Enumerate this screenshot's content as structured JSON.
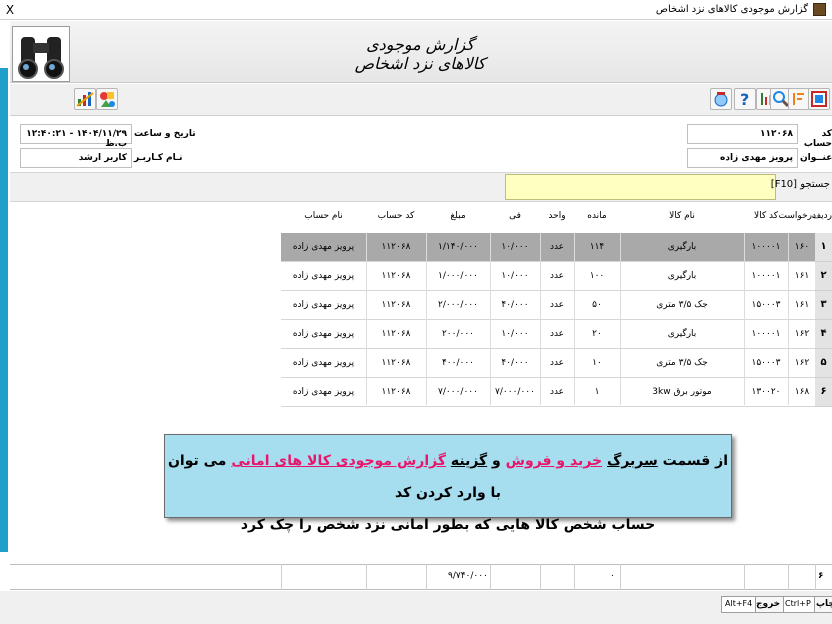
{
  "window": {
    "title": "گزارش موجودی کالاهای نزد اشخاص",
    "close_label": "X"
  },
  "header": {
    "title": "گزارش موجودی کالاهای نزد اشخاص"
  },
  "info": {
    "account_code_label": "کد حساب",
    "account_code_value": "۱۱۲۰۶۸",
    "title_label": "عنــوان",
    "title_value": "پرویز مهدی زاده",
    "datetime_label": "تاریخ و ساعت",
    "datetime_value": "۱۴۰۴/۱۱/۲۹ - ۱۲:۴۰:۲۱ ب.ظ",
    "user_label": "نـام کـاربـر",
    "user_value": "کاربر ارشد"
  },
  "search": {
    "label": "جستجو [F10]",
    "value": ""
  },
  "table": {
    "columns": [
      "ردیف",
      "درخواست",
      "کد کالا",
      "نام کالا",
      "مانده",
      "واحد",
      "فی",
      "مبلغ",
      "کد حساب",
      "نام حساب"
    ],
    "rows": [
      {
        "idx": "۱",
        "req": "۱۶۰",
        "code": "۱۰۰۰۰۱",
        "name": "بارگیری",
        "rem": "۱۱۴",
        "unit": "عدد",
        "price": "۱۰/۰۰۰",
        "amount": "۱/۱۴۰/۰۰۰",
        "acc": "۱۱۲۰۶۸",
        "accname": "پرویز مهدی زاده"
      },
      {
        "idx": "۲",
        "req": "۱۶۱",
        "code": "۱۰۰۰۰۱",
        "name": "بارگیری",
        "rem": "۱۰۰",
        "unit": "عدد",
        "price": "۱۰/۰۰۰",
        "amount": "۱/۰۰۰/۰۰۰",
        "acc": "۱۱۲۰۶۸",
        "accname": "پرویز مهدی زاده"
      },
      {
        "idx": "۳",
        "req": "۱۶۱",
        "code": "۱۵۰۰۰۳",
        "name": "جک ۳/۵ متری",
        "rem": "۵۰",
        "unit": "عدد",
        "price": "۴۰/۰۰۰",
        "amount": "۲/۰۰۰/۰۰۰",
        "acc": "۱۱۲۰۶۸",
        "accname": "پرویز مهدی زاده"
      },
      {
        "idx": "۴",
        "req": "۱۶۲",
        "code": "۱۰۰۰۰۱",
        "name": "بارگیری",
        "rem": "۲۰",
        "unit": "عدد",
        "price": "۱۰/۰۰۰",
        "amount": "۲۰۰/۰۰۰",
        "acc": "۱۱۲۰۶۸",
        "accname": "پرویز مهدی زاده"
      },
      {
        "idx": "۵",
        "req": "۱۶۲",
        "code": "۱۵۰۰۰۳",
        "name": "جک ۳/۵ متری",
        "rem": "۱۰",
        "unit": "عدد",
        "price": "۴۰/۰۰۰",
        "amount": "۴۰۰/۰۰۰",
        "acc": "۱۱۲۰۶۸",
        "accname": "پرویز مهدی زاده"
      },
      {
        "idx": "۶",
        "req": "۱۶۸",
        "code": "۱۳۰۰۲۰",
        "name": "موتور برق 3kw",
        "rem": "۱",
        "unit": "عدد",
        "price": "۷/۰۰۰/۰۰۰",
        "amount": "۷/۰۰۰/۰۰۰",
        "acc": "۱۱۲۰۶۸",
        "accname": "پرویز مهدی زاده"
      }
    ]
  },
  "callout": {
    "line1_a": "از قسمت ",
    "line1_b": "سربرگ",
    "line1_c": " ",
    "line1_d": "خرید و فروش",
    "line1_e": " و ",
    "line1_f": "گزینه",
    "line1_g": " ",
    "line1_h": "گزارش موجودی کالا های امانی",
    "line1_i": " می توان با وارد کردن کد",
    "line2": "حساب شخص کالا هایی که بطور امانی نزد شخص را چک کرد"
  },
  "footer": {
    "count": "۶",
    "remainder_total": "۰",
    "amount_total": "۹/۷۴۰/۰۰۰"
  },
  "bottom": {
    "print_label": "چاپ",
    "print_key": "Ctrl+P",
    "exit_label": "خروج",
    "exit_key": "Alt+F4"
  },
  "colors": {
    "accent_stripe": "#1f9fc9",
    "selected_row": "#a9a9a9",
    "search_bg": "#ffffc0",
    "callout_bg": "#a6ddef",
    "highlight_text": "#e8156a"
  }
}
